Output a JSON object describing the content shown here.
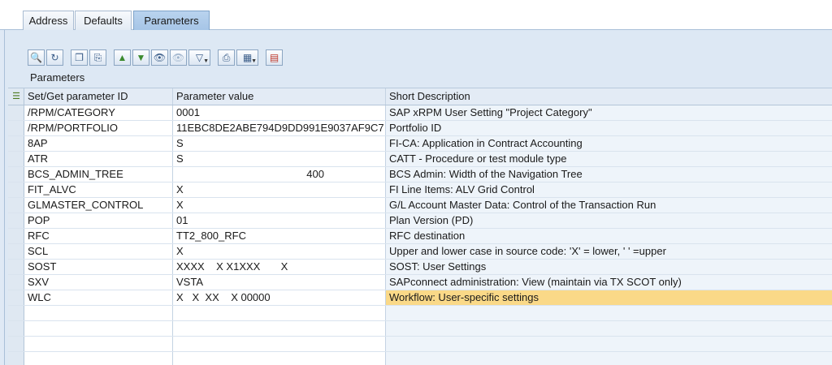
{
  "tabs": [
    {
      "label": "Address",
      "active": false
    },
    {
      "label": "Defaults",
      "active": false
    },
    {
      "label": "Parameters",
      "active": true
    }
  ],
  "toolbar": {
    "icons": [
      "details-icon",
      "refresh-icon",
      "copy-icon",
      "paste-icon",
      "sort-ascending-icon",
      "sort-descending-icon",
      "find-icon",
      "find-next-icon",
      "filter-icon",
      "print-icon",
      "layout-icon",
      "info-icon"
    ]
  },
  "grid": {
    "title": "Parameters",
    "columns": [
      "Set/Get parameter ID",
      "Parameter value",
      "Short Description"
    ],
    "rows": [
      {
        "id": "/RPM/CATEGORY",
        "value": "0001",
        "desc": "SAP xRPM User Setting \"Project Category\""
      },
      {
        "id": "/RPM/PORTFOLIO",
        "value": "11EBC8DE2ABE794D9DD991E9037AF9C7",
        "desc": "Portfolio ID"
      },
      {
        "id": "8AP",
        "value": "S",
        "desc": "FI-CA: Application in Contract Accounting"
      },
      {
        "id": "ATR",
        "value": "S",
        "desc": "CATT - Procedure or test module type"
      },
      {
        "id": "BCS_ADMIN_TREE",
        "value": "400",
        "desc": "BCS Admin: Width of the Navigation Tree",
        "numeric": true
      },
      {
        "id": "FIT_ALVC",
        "value": "X",
        "desc": "FI Line Items: ALV Grid Control"
      },
      {
        "id": "GLMASTER_CONTROL",
        "value": "X",
        "desc": "G/L Account Master Data: Control of the Transaction Run"
      },
      {
        "id": "POP",
        "value": "01",
        "desc": "Plan Version (PD)"
      },
      {
        "id": "RFC",
        "value": "TT2_800_RFC",
        "desc": "RFC destination"
      },
      {
        "id": "SCL",
        "value": "X",
        "desc": "Upper and lower case in source code: 'X' = lower, ' ' =upper"
      },
      {
        "id": "SOST",
        "value": "XXXX    X X1XXX       X",
        "desc": "SOST: User Settings"
      },
      {
        "id": "SXV",
        "value": "VSTA",
        "desc": "SAPconnect administration: View (maintain via TX SCOT only)"
      },
      {
        "id": "WLC",
        "value": "X   X  XX    X 00000",
        "desc": "Workflow: User-specific settings",
        "selected": true
      }
    ],
    "empty_rows": 4
  }
}
